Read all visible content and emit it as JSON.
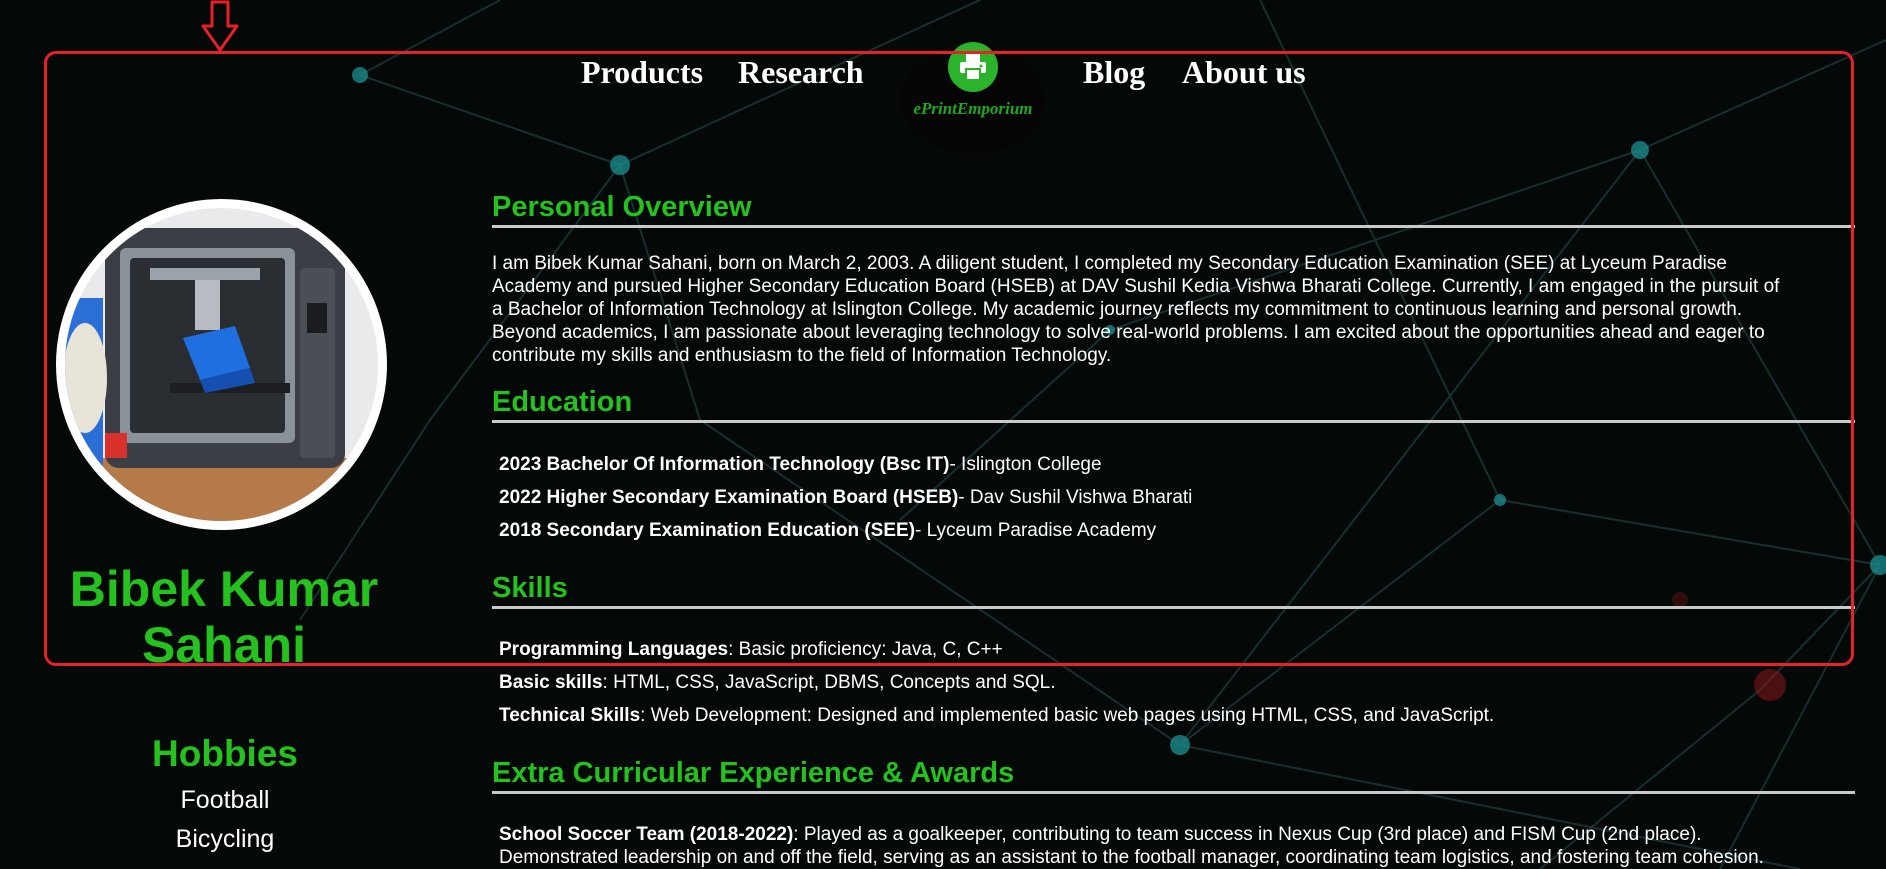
{
  "nav": {
    "left": [
      "Products",
      "Research"
    ],
    "right": [
      "Blog",
      "About us"
    ],
    "logo_text": "ePrintEmporium",
    "logo_icon": "printer-icon"
  },
  "profile": {
    "name_line1": "Bibek Kumar",
    "name_line2": "Sahani",
    "photo": "3d-printer-photo"
  },
  "hobbies": {
    "title": "Hobbies",
    "items": [
      "Football",
      "Bicycling"
    ]
  },
  "overview": {
    "title": "Personal Overview",
    "lines": [
      "I am Bibek Kumar Sahani, born on March 2, 2003. A diligent student, I completed my Secondary Education Examination (SEE) at Lyceum Paradise",
      "Academy and pursued Higher Secondary Education Board (HSEB) at DAV Sushil Kedia Vishwa Bharati College. Currently, I am engaged in the pursuit of",
      "a Bachelor of Information Technology at Islington College. My academic journey reflects my commitment to continuous learning and personal growth.",
      "Beyond academics, I am passionate about leveraging technology to solve real-world problems. I am excited about the opportunities ahead and eager to",
      "contribute my skills and enthusiasm to the field of Information Technology."
    ]
  },
  "education": {
    "title": "Education",
    "items": [
      {
        "strong": "2023 Bachelor Of Information Technology (Bsc IT)",
        "text": "- Islington College"
      },
      {
        "strong": "2022 Higher Secondary Examination Board (HSEB)",
        "text": "- Dav Sushil Vishwa Bharati"
      },
      {
        "strong": "2018 Secondary Examination Education (SEE)",
        "text": "- Lyceum Paradise Academy"
      }
    ]
  },
  "skills": {
    "title": "Skills",
    "items": [
      {
        "strong": "Programming Languages",
        "text": ": Basic proficiency: Java, C, C++"
      },
      {
        "strong": "Basic skills",
        "text": ": HTML, CSS, JavaScript, DBMS, Concepts and SQL."
      },
      {
        "strong": "Technical Skills",
        "text": ": Web Development: Designed and implemented basic web pages using HTML, CSS, and JavaScript."
      }
    ]
  },
  "extra": {
    "title": "Extra Curricular Experience & Awards",
    "items": [
      {
        "strong": "School Soccer Team (2018-2022)",
        "text": ": Played as a goalkeeper, contributing to team success in Nexus Cup (3rd place) and FISM Cup (2nd place)."
      }
    ],
    "cont_line": "Demonstrated leadership on and off the field, serving as an assistant to the football manager, coordinating team logistics, and fostering team cohesion."
  },
  "colors": {
    "accent_green": "#25c11f",
    "annotation_red": "#e8202a",
    "background": "#040807"
  }
}
